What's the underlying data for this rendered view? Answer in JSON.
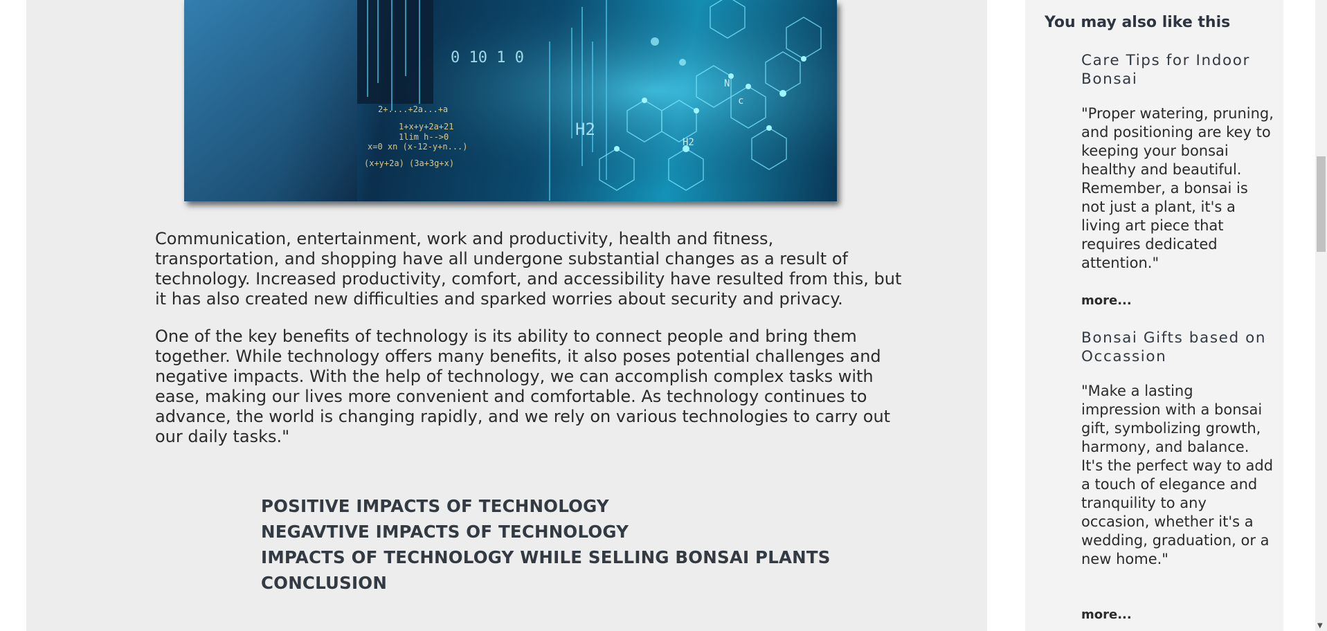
{
  "article": {
    "paragraphs": [
      "Communication, entertainment, work and productivity, health and fitness, transportation, and shopping have all undergone substantial changes as a result of technology. Increased productivity, comfort, and accessibility have resulted from this, but it has also created new difficulties and sparked worries about security and privacy.",
      "One of the key benefits of technology is its ability to connect people and bring them together. While technology offers many benefits, it also poses potential challenges and negative impacts. With the help of technology, we can accomplish complex tasks with ease, making our lives more convenient and comfortable. As technology continues to advance, the world is changing rapidly, and we rely on various technologies to carry out our daily tasks.\""
    ],
    "toc": [
      "POSITIVE IMPACTS OF TECHNOLOGY",
      "NEGAVTIVE IMPACTS OF TECHNOLOGY",
      "IMPACTS OF TECHNOLOGY WHILE SELLING BONSAI PLANTS",
      "CONCLUSION"
    ],
    "hero_formulas": [
      "0 10 1 0",
      "2+....+2a...+a",
      "1+x+y+2a+21",
      "1lim h-->0",
      "x=0 xn (x-12-y+n...)",
      "(x+y+2a) (3a+3g+x)",
      "H2",
      "H2",
      "N",
      "c"
    ]
  },
  "sidebar": {
    "heading": "You may also like this",
    "items": [
      {
        "title": "Care Tips for Indoor Bonsai",
        "quote": "\"Proper watering, pruning, and positioning are key to keeping your bonsai healthy and beautiful. Remember, a bonsai is not just a plant, it's a living art piece that requires dedicated attention.\"",
        "more": "more..."
      },
      {
        "title": "Bonsai Gifts based on Occassion",
        "quote": "\"Make a lasting impression with a bonsai gift, symbolizing growth, harmony, and balance. It's the perfect way to add a touch of elegance and tranquility to any occasion, whether it's a wedding, graduation, or a new home.\"",
        "more": "more..."
      }
    ]
  },
  "colors": {
    "main_bg": "#ededed",
    "sidebar_bg": "#f3f3f3",
    "heading_text": "#333a42"
  }
}
